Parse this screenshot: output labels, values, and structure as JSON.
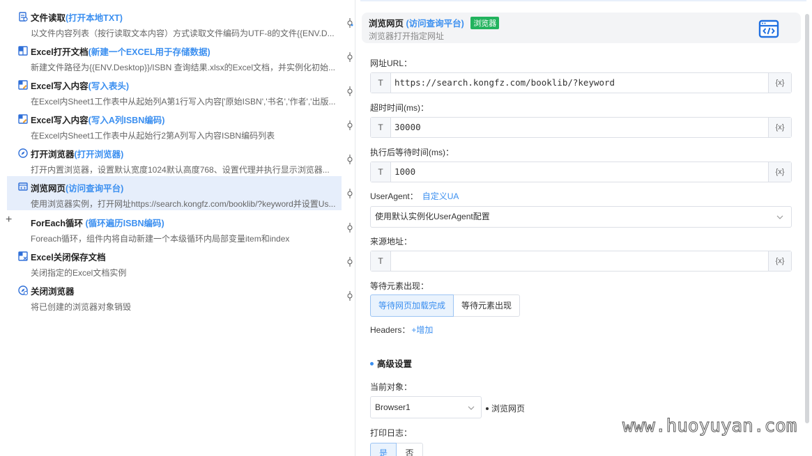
{
  "steps": [
    {
      "title": "文件读取",
      "sub": "(打开本地TXT)",
      "desc": "以文件内容列表（按行读取文本内容）方式读取文件编码为UTF-8的文件{{ENV.D...",
      "icon": "file-read-icon"
    },
    {
      "title": "Excel打开文档",
      "sub": "(新建一个EXCEL用于存储数据)",
      "desc": "新建文件路径为{{ENV.Desktop}}/ISBN 查询结果.xlsx的Excel文档，并实例化初始...",
      "icon": "excel-icon"
    },
    {
      "title": "Excel写入内容",
      "sub": "(写入表头)",
      "desc": "在Excel内Sheet1工作表中从起始列A第1行写入内容['原始ISBN','书名','作者','出版...",
      "icon": "excel-write-icon"
    },
    {
      "title": "Excel写入内容",
      "sub": "(写入A列ISBN编码)",
      "desc": "在Excel内Sheet1工作表中从起始行2第A列写入内容ISBN编码列表",
      "icon": "excel-write-icon"
    },
    {
      "title": "打开浏览器",
      "sub": "(打开浏览器)",
      "desc": "打开内置浏览器，设置默认宽度1024默认高度768、设置代理并执行显示浏览器...",
      "icon": "compass-icon"
    },
    {
      "title": "浏览网页",
      "sub": "(访问查询平台)",
      "desc": "使用浏览器实例，打开网址https://search.kongfz.com/booklib/?keyword并设置Us...",
      "icon": "browser-icon"
    },
    {
      "title": "ForEach循环",
      "sub": "(循环遍历ISBN编码)",
      "desc": "Foreach循环，组件内将自动新建一个本级循环内局部变量item和index",
      "icon": "loop-icon"
    },
    {
      "title": "Excel关闭保存文档",
      "sub": "",
      "desc": "关闭指定的Excel文档实例",
      "icon": "excel-close-icon"
    },
    {
      "title": "关闭浏览器",
      "sub": "",
      "desc": "将已创建的浏览器对象销毁",
      "icon": "browser-close-icon"
    }
  ],
  "expand_symbol": "+",
  "panel": {
    "title": "浏览网页",
    "title_sub": "(访问查询平台)",
    "tag": "浏览器",
    "desc": "浏览器打开指定网址",
    "url_label": "网址URL：",
    "url_value": "https://search.kongfz.com/booklib/?keyword",
    "timeout_label": "超时时间(ms)：",
    "timeout_value": "30000",
    "wait_label": "执行后等待时间(ms)：",
    "wait_value": "1000",
    "ua_label": "UserAgent：",
    "ua_link": "自定义UA",
    "ua_select": "使用默认实例化UserAgent配置",
    "referer_label": "来源地址：",
    "referer_value": "",
    "appear_label": "等待元素出现：",
    "appear_opt1": "等待网页加载完成",
    "appear_opt2": "等待元素出现",
    "headers_label": "Headers：",
    "headers_add": "+增加",
    "advanced_label": "高级设置",
    "object_label": "当前对象：",
    "object_value": "Browser1",
    "object_note": "浏览网页",
    "log_label": "打印日志：",
    "log_yes": "是",
    "log_no": "否",
    "prefix_t": "T",
    "suffix_x": "{x}"
  },
  "watermark": "www.huoyuyan.com",
  "colors": {
    "accent": "#3b8ff0",
    "tag_green": "#22b35e",
    "active_bg": "#e6eefb"
  }
}
